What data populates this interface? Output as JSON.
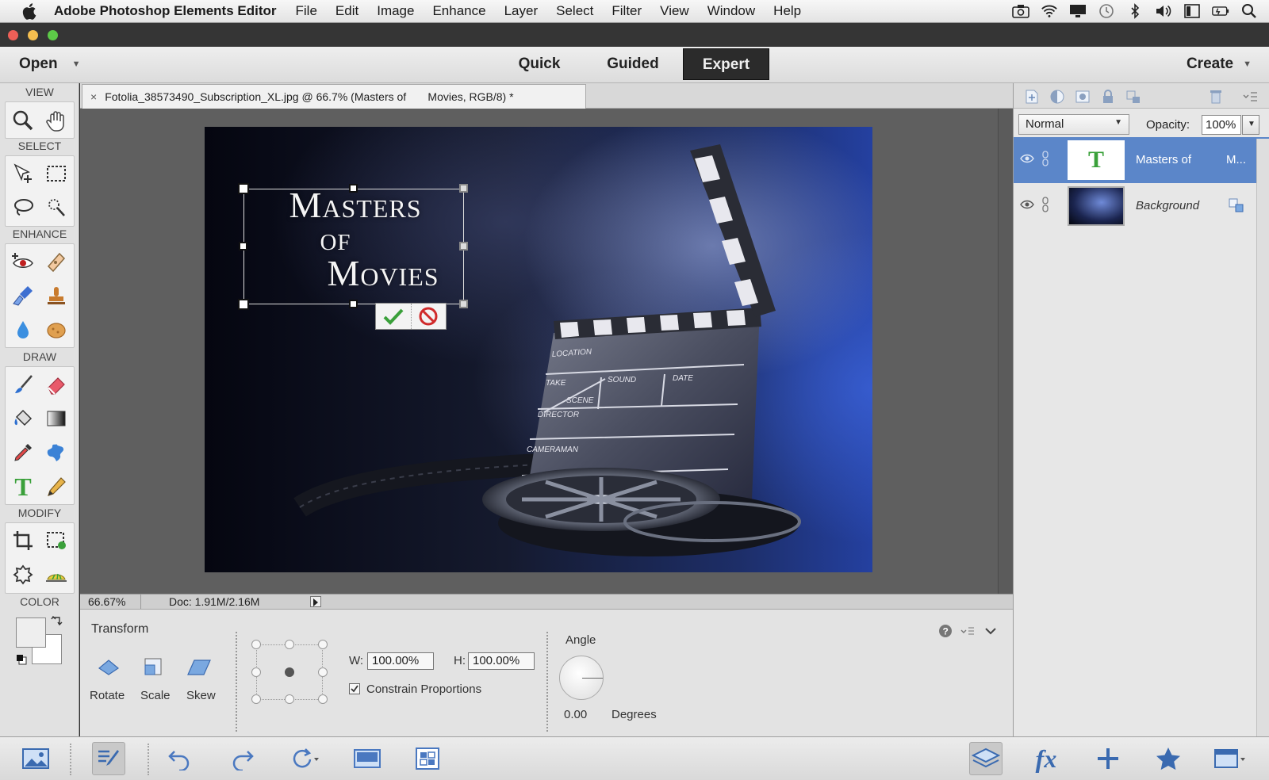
{
  "menubar": {
    "app_name": "Adobe Photoshop Elements Editor",
    "items": [
      "File",
      "Edit",
      "Image",
      "Enhance",
      "Layer",
      "Select",
      "Filter",
      "View",
      "Window",
      "Help"
    ],
    "status_icons": [
      "camera-icon",
      "wifi-icon",
      "display-icon",
      "clock-icon",
      "bluetooth-icon",
      "volume-icon",
      "sidebar-icon",
      "battery-icon",
      "spotlight-icon"
    ]
  },
  "window": {
    "traffic_lights": [
      "#ee5f57",
      "#f5be4f",
      "#5dca48"
    ]
  },
  "modebar": {
    "open_label": "Open",
    "tabs": [
      "Quick",
      "Guided",
      "Expert"
    ],
    "active_tab": "Expert",
    "create_label": "Create"
  },
  "toolbox": {
    "sections": {
      "view": "VIEW",
      "select": "SELECT",
      "enhance": "ENHANCE",
      "draw": "DRAW",
      "modify": "MODIFY",
      "color": "COLOR"
    },
    "tools": {
      "view": [
        "zoom-icon",
        "hand-icon"
      ],
      "select": [
        "move-icon",
        "marquee-icon",
        "lasso-icon",
        "quick-selection-icon"
      ],
      "enhance": [
        "red-eye-icon",
        "spot-healing-icon",
        "smart-brush-icon",
        "clone-stamp-icon",
        "blur-icon",
        "sponge-icon"
      ],
      "draw": [
        "brush-icon",
        "eraser-icon",
        "paint-bucket-icon",
        "gradient-icon",
        "eyedropper-icon",
        "custom-shape-icon",
        "type-icon",
        "pencil-icon"
      ],
      "modify": [
        "crop-icon",
        "recompose-icon",
        "content-aware-move-icon",
        "straighten-icon"
      ]
    },
    "foreground_color": "#eeeeee",
    "background_color": "#ffffff"
  },
  "document": {
    "tab_title": "Fotolia_38573490_Subscription_XL.jpg @ 66.7% (Masters of       Movies, RGB/8) *",
    "close_glyph": "×",
    "text_layer_lines": [
      "Masters",
      "of",
      "Movies"
    ],
    "clapper_labels": [
      "LOCATION",
      "TAKE",
      "SOUND",
      "DATE",
      "SCENE",
      "DIRECTOR",
      "CAMERAMAN"
    ]
  },
  "statusbar": {
    "zoom": "66.67%",
    "doc": "Doc: 1.91M/2.16M"
  },
  "tool_options": {
    "title": "Transform",
    "modes": [
      "Rotate",
      "Scale",
      "Skew"
    ],
    "w_label": "W:",
    "w_value": "100.00%",
    "h_label": "H:",
    "h_value": "100.00%",
    "constrain_label": "Constrain Proportions",
    "constrain_checked": true,
    "angle_label": "Angle",
    "angle_value": "0.00",
    "degrees_label": "Degrees"
  },
  "layers": {
    "blend_mode": "Normal",
    "opacity_label": "Opacity:",
    "opacity_value": "100%",
    "items": [
      {
        "name": "Masters of",
        "extra": "M...",
        "thumb_glyph": "T",
        "selected": true
      },
      {
        "name": "Background",
        "extra": "",
        "selected": false
      }
    ],
    "selected_color": "#5b86c9"
  },
  "taskbar": {
    "buttons": [
      "photo-bin-icon",
      "tool-options-icon",
      "undo-icon",
      "redo-icon",
      "rotate-icon",
      "layout-icon",
      "organizer-icon",
      "layers-icon",
      "effects-icon",
      "add-icon",
      "favorites-icon",
      "more-icon"
    ],
    "fx_label": "fx"
  }
}
